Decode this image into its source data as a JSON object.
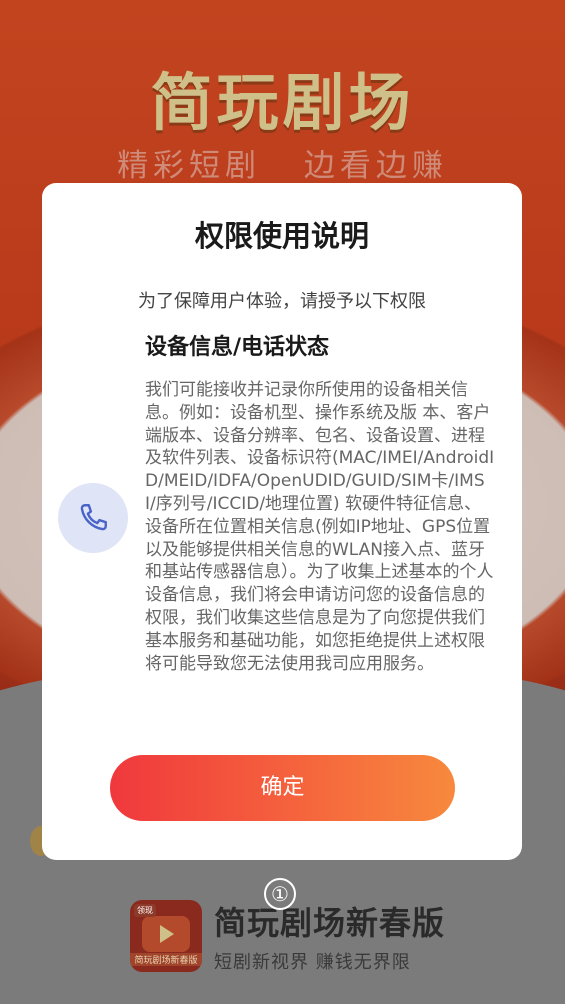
{
  "splash": {
    "title": "简玩剧场",
    "subtitle_left": "精彩短剧",
    "subtitle_right": "边看边赚"
  },
  "brand": {
    "name": "简玩剧场新春版",
    "slogan": "短剧新视界 赚钱无界限",
    "logo_badge": "领现",
    "logo_ribbon": "简玩剧场新春版"
  },
  "dialog": {
    "title": "权限使用说明",
    "intro": "为了保障用户体验，请授予以下权限",
    "permission": {
      "icon": "phone-icon",
      "title": "设备信息/电话状态",
      "description": "我们可能接收并记录你所使用的设备相关信息。例如：设备机型、操作系统及版 本、客户端版本、设备分辨率、包名、设备设置、进程及软件列表、设备标识符(MAC/IMEI/AndroidID/MEID/IDFA/OpenUDID/GUID/SIM卡/IMSI/序列号/ICCID/地理位置) 软硬件特征信息、设备所在位置相关信息(例如IP地址、GPS位置以及能够提供相关信息的WLAN接入点、蓝牙和基站传感器信息）。为了收集上述基本的个人设备信息，我们将会申请访问您的设备信息的权限，我们收集这些信息是为了向您提供我们基本服务和基础功能，如您拒绝提供上述权限将可能导致您无法使用我司应用服务。"
    },
    "confirm_label": "确定"
  },
  "step_marker": "①",
  "colors": {
    "button_gradient_start": "#f0383d",
    "button_gradient_end": "#f7893d",
    "icon_bg": "#dfe5f7",
    "icon_stroke": "#4a63c8"
  }
}
